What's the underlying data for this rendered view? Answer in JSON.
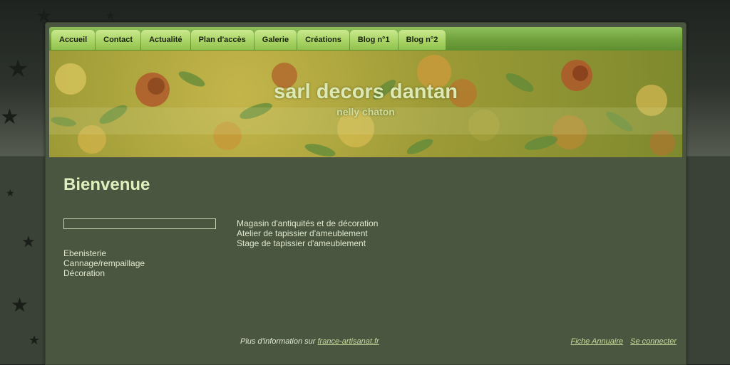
{
  "nav": {
    "tabs": [
      "Accueil",
      "Contact",
      "Actualité",
      "Plan d'accès",
      "Galerie",
      "Créations",
      "Blog n°1",
      "Blog n°2"
    ]
  },
  "banner": {
    "title": "sarl decors dantan",
    "subtitle": "nelly chaton"
  },
  "main": {
    "heading": "Bienvenue",
    "sidebar_items": [
      "Ebenisterie",
      "Cannage/rempaillage",
      "Décoration"
    ],
    "content_lines": [
      "Magasin  d'antiquités et de décoration",
      "Atelier de tapissier d'ameublement",
      "Stage de tapissier d'ameublement"
    ]
  },
  "footer": {
    "info_prefix": "Plus d'information sur ",
    "info_link": "france-artisanat.fr",
    "links": [
      "Fiche Annuaire",
      "Se connecter"
    ]
  },
  "colors": {
    "nav_tab": "#a9d466",
    "page_bg": "#4b5640",
    "heading": "#dfeebd",
    "link": "#c8d89a"
  }
}
